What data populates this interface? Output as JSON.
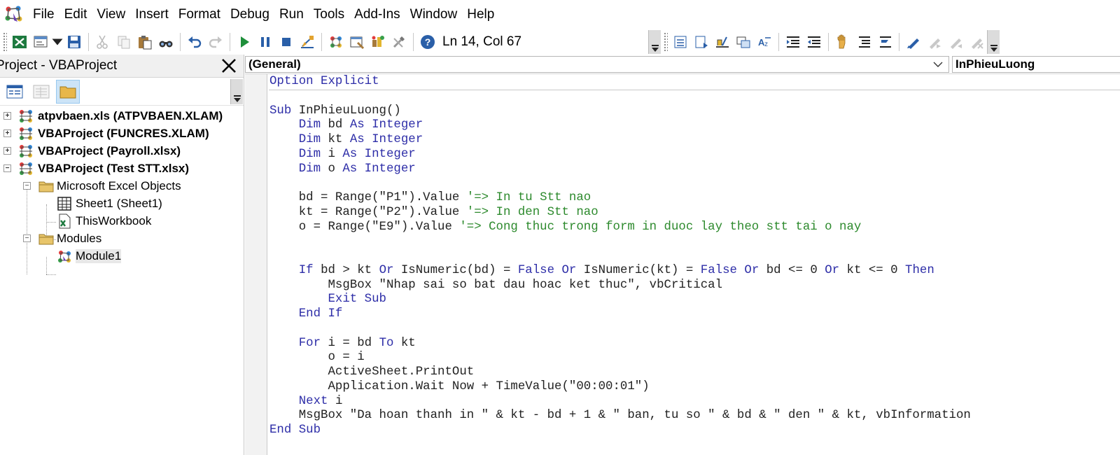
{
  "menubar": {
    "items": [
      "File",
      "Edit",
      "View",
      "Insert",
      "Format",
      "Debug",
      "Run",
      "Tools",
      "Add-Ins",
      "Window",
      "Help"
    ]
  },
  "toolbar": {
    "status": "Ln 14, Col 67",
    "icons": [
      "excel-view-icon",
      "insert-userform-icon",
      "save-icon",
      "cut-icon",
      "copy-icon",
      "paste-icon",
      "find-icon",
      "undo-icon",
      "redo-icon",
      "run-icon",
      "break-icon",
      "reset-icon",
      "design-mode-icon",
      "project-explorer-icon",
      "properties-icon",
      "object-browser-icon",
      "toolbox-icon",
      "help-icon"
    ],
    "edit_icons": [
      "list-properties-icon",
      "list-constants-icon",
      "quick-info-icon",
      "parameter-info-icon",
      "complete-word-icon",
      "indent-icon",
      "outdent-icon",
      "toggle-breakpoint-icon",
      "comment-block-icon",
      "uncomment-block-icon",
      "toggle-bookmark-icon",
      "next-bookmark-icon",
      "previous-bookmark-icon",
      "clear-bookmarks-icon"
    ]
  },
  "project_panel": {
    "title": "Project - VBAProject",
    "tree": [
      {
        "label": "atpvbaen.xls (ATPVBAEN.XLAM)",
        "bold": true,
        "expander": "+"
      },
      {
        "label": "VBAProject (FUNCRES.XLAM)",
        "bold": true,
        "expander": "+"
      },
      {
        "label": "VBAProject (Payroll.xlsx)",
        "bold": true,
        "expander": "+"
      },
      {
        "label": "VBAProject (Test STT.xlsx)",
        "bold": true,
        "expander": "-"
      },
      {
        "label": "Microsoft Excel Objects",
        "bold": false,
        "expander": "-"
      },
      {
        "label": "Sheet1 (Sheet1)",
        "bold": false
      },
      {
        "label": "ThisWorkbook",
        "bold": false
      },
      {
        "label": "Modules",
        "bold": false,
        "expander": "-"
      },
      {
        "label": "Module1",
        "bold": false,
        "selected": true
      }
    ]
  },
  "code_window": {
    "object_combo": "(General)",
    "proc_combo": "InPhieuLuong",
    "lines": [
      [
        {
          "t": "kw",
          "s": "Option Explicit"
        }
      ],
      [],
      [
        {
          "t": "kw",
          "s": "Sub "
        },
        {
          "t": "tx",
          "s": "InPhieuLuong()"
        }
      ],
      [
        {
          "t": "tx",
          "s": "    "
        },
        {
          "t": "kw",
          "s": "Dim "
        },
        {
          "t": "tx",
          "s": "bd "
        },
        {
          "t": "kw",
          "s": "As Integer"
        }
      ],
      [
        {
          "t": "tx",
          "s": "    "
        },
        {
          "t": "kw",
          "s": "Dim "
        },
        {
          "t": "tx",
          "s": "kt "
        },
        {
          "t": "kw",
          "s": "As Integer"
        }
      ],
      [
        {
          "t": "tx",
          "s": "    "
        },
        {
          "t": "kw",
          "s": "Dim "
        },
        {
          "t": "tx",
          "s": "i "
        },
        {
          "t": "kw",
          "s": "As Integer"
        }
      ],
      [
        {
          "t": "tx",
          "s": "    "
        },
        {
          "t": "kw",
          "s": "Dim "
        },
        {
          "t": "tx",
          "s": "o "
        },
        {
          "t": "kw",
          "s": "As Integer"
        }
      ],
      [],
      [
        {
          "t": "tx",
          "s": "    bd = Range(\"P1\").Value "
        },
        {
          "t": "cm",
          "s": "'=> In tu Stt nao"
        }
      ],
      [
        {
          "t": "tx",
          "s": "    kt = Range(\"P2\").Value "
        },
        {
          "t": "cm",
          "s": "'=> In den Stt nao"
        }
      ],
      [
        {
          "t": "tx",
          "s": "    o = Range(\"E9\").Value "
        },
        {
          "t": "cm",
          "s": "'=> Cong thuc trong form in duoc lay theo stt tai o nay"
        }
      ],
      [],
      [],
      [
        {
          "t": "tx",
          "s": "    "
        },
        {
          "t": "kw",
          "s": "If "
        },
        {
          "t": "tx",
          "s": "bd > kt "
        },
        {
          "t": "kw",
          "s": "Or "
        },
        {
          "t": "tx",
          "s": "IsNumeric(bd) = "
        },
        {
          "t": "kw",
          "s": "False Or "
        },
        {
          "t": "tx",
          "s": "IsNumeric(kt) = "
        },
        {
          "t": "kw",
          "s": "False Or "
        },
        {
          "t": "tx",
          "s": "bd <= 0 "
        },
        {
          "t": "kw",
          "s": "Or "
        },
        {
          "t": "tx",
          "s": "kt <= 0 "
        },
        {
          "t": "kw",
          "s": "Then"
        }
      ],
      [
        {
          "t": "tx",
          "s": "        MsgBox \"Nhap sai so bat dau hoac ket thuc\", vbCritical"
        }
      ],
      [
        {
          "t": "tx",
          "s": "        "
        },
        {
          "t": "kw",
          "s": "Exit Sub"
        }
      ],
      [
        {
          "t": "tx",
          "s": "    "
        },
        {
          "t": "kw",
          "s": "End If"
        }
      ],
      [],
      [
        {
          "t": "tx",
          "s": "    "
        },
        {
          "t": "kw",
          "s": "For "
        },
        {
          "t": "tx",
          "s": "i = bd "
        },
        {
          "t": "kw",
          "s": "To "
        },
        {
          "t": "tx",
          "s": "kt"
        }
      ],
      [
        {
          "t": "tx",
          "s": "        o = i"
        }
      ],
      [
        {
          "t": "tx",
          "s": "        ActiveSheet.PrintOut"
        }
      ],
      [
        {
          "t": "tx",
          "s": "        Application.Wait Now + TimeValue(\"00:00:01\")"
        }
      ],
      [
        {
          "t": "tx",
          "s": "    "
        },
        {
          "t": "kw",
          "s": "Next "
        },
        {
          "t": "tx",
          "s": "i"
        }
      ],
      [
        {
          "t": "tx",
          "s": "    MsgBox \"Da hoan thanh in \" & kt - bd + 1 & \" ban, tu so \" & bd & \" den \" & kt, vbInformation"
        }
      ],
      [
        {
          "t": "kw",
          "s": "End Sub"
        }
      ]
    ]
  }
}
